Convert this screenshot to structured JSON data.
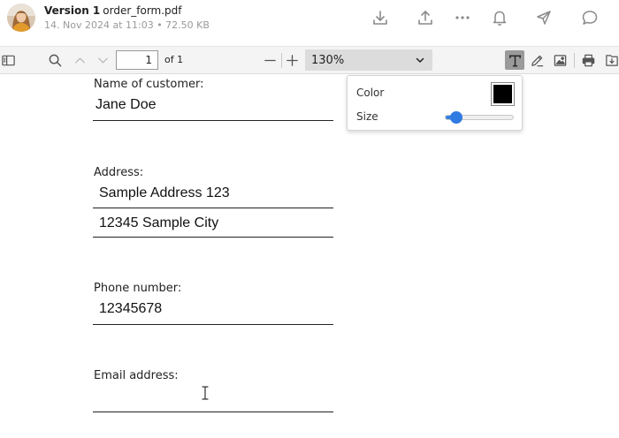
{
  "header": {
    "version_label": "Version 1",
    "file_name": "order_form.pdf",
    "meta": "14. Nov 2024 at 11:03 • 72.50 KB",
    "icons": [
      "download-icon",
      "share-icon",
      "more-icon",
      "bell-icon",
      "send-icon",
      "comment-icon"
    ]
  },
  "toolbar": {
    "page_input": "1",
    "page_of": "of 1",
    "zoom_value": "130%",
    "active_tool": "text-tool",
    "accent_color": "#9a9a9a"
  },
  "document": {
    "fields": [
      {
        "label": "Name of customer:",
        "values": [
          "Jane Doe"
        ]
      },
      {
        "label": "Address:",
        "values": [
          "Sample Address 123",
          "12345 Sample City"
        ]
      },
      {
        "label": "Phone number:",
        "values": [
          "12345678"
        ]
      },
      {
        "label": "Email address:",
        "values": [
          ""
        ]
      }
    ]
  },
  "text_popup": {
    "color_label": "Color",
    "color_value": "#000000",
    "size_label": "Size",
    "size_level": 0.1
  }
}
